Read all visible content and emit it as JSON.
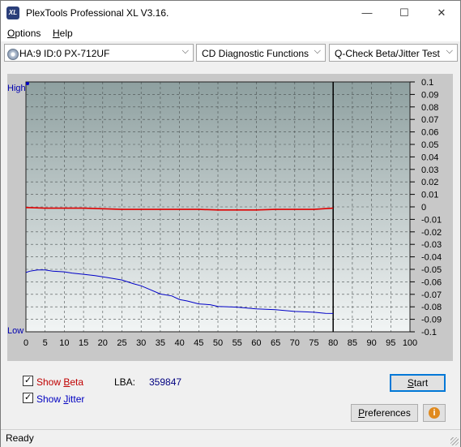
{
  "window": {
    "title": "PlexTools Professional XL V3.16.",
    "app_icon": "XL"
  },
  "window_buttons": {
    "minimize": "—",
    "maximize": "☐",
    "close": "✕"
  },
  "menu": [
    {
      "label_first": "O",
      "label_rest": "ptions"
    },
    {
      "label_first": "H",
      "label_rest": "elp"
    }
  ],
  "toolbar": {
    "drive": "HA:9 ID:0  PX-712UF",
    "function": "CD Diagnostic Functions",
    "test": "Q-Check Beta/Jitter Test"
  },
  "chart_data": {
    "type": "line",
    "y_left_labels": {
      "high": "High",
      "low": "Low"
    },
    "x_ticks": [
      "0",
      "5",
      "10",
      "15",
      "20",
      "25",
      "30",
      "35",
      "40",
      "45",
      "50",
      "55",
      "60",
      "65",
      "70",
      "75",
      "80",
      "85",
      "90",
      "95",
      "100"
    ],
    "y_ticks": [
      "0.1",
      "0.09",
      "0.08",
      "0.07",
      "0.06",
      "0.05",
      "0.04",
      "0.03",
      "0.02",
      "0.01",
      "0",
      "-0.01",
      "-0.02",
      "-0.03",
      "-0.04",
      "-0.05",
      "-0.06",
      "-0.07",
      "-0.08",
      "-0.09",
      "-0.1"
    ],
    "xlim": [
      0,
      100
    ],
    "ylim": [
      -0.1,
      0.1
    ],
    "scan_end_x": 80,
    "grid": true,
    "series": [
      {
        "name": "Beta",
        "color": "#e00000",
        "x": [
          0,
          5,
          10,
          15,
          20,
          25,
          30,
          35,
          40,
          45,
          50,
          55,
          60,
          65,
          70,
          75,
          80
        ],
        "y": [
          -0.0005,
          -0.001,
          -0.001,
          -0.001,
          -0.0015,
          -0.002,
          -0.002,
          -0.002,
          -0.002,
          -0.002,
          -0.0025,
          -0.0025,
          -0.0025,
          -0.002,
          -0.002,
          -0.002,
          -0.001
        ]
      },
      {
        "name": "Jitter",
        "color": "#0000c8",
        "x": [
          0,
          1,
          3,
          5,
          7,
          10,
          12,
          15,
          18,
          20,
          22,
          25,
          28,
          30,
          32,
          35,
          38,
          40,
          42,
          45,
          48,
          50,
          55,
          60,
          65,
          70,
          75,
          78,
          80
        ],
        "y": [
          -0.0525,
          -0.0515,
          -0.0505,
          -0.0505,
          -0.0515,
          -0.052,
          -0.053,
          -0.054,
          -0.055,
          -0.056,
          -0.057,
          -0.0585,
          -0.0615,
          -0.063,
          -0.066,
          -0.0695,
          -0.0715,
          -0.074,
          -0.0755,
          -0.0775,
          -0.0785,
          -0.0795,
          -0.0805,
          -0.0815,
          -0.0825,
          -0.0835,
          -0.0845,
          -0.085,
          -0.0855
        ]
      }
    ]
  },
  "controls": {
    "show_beta": {
      "checked": true,
      "label_first": "Show ",
      "label_ul": "B",
      "label_rest": "eta",
      "color": "#c00000"
    },
    "show_jitter": {
      "checked": true,
      "label_first": "Show ",
      "label_ul": "J",
      "label_rest": "itter",
      "color": "#0000c0"
    },
    "lba_label": "LBA:",
    "lba_value": "359847",
    "start_button": {
      "label_ul": "S",
      "label_rest": "tart"
    },
    "preferences_button": {
      "label_ul": "P",
      "label_rest": "references"
    },
    "info_icon": "i"
  },
  "status": {
    "text": "Ready"
  }
}
